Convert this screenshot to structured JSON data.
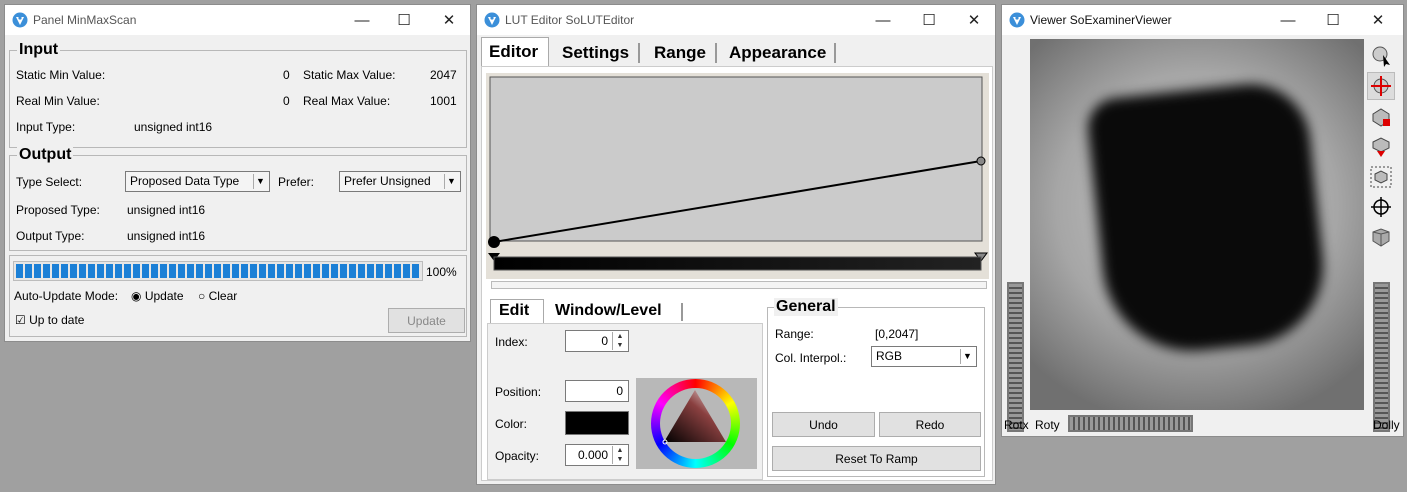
{
  "panel": {
    "title": "Panel MinMaxScan",
    "input": {
      "title": "Input",
      "static_min_label": "Static Min Value:",
      "static_min_value": "0",
      "static_max_label": "Static Max Value:",
      "static_max_value": "2047",
      "real_min_label": "Real Min Value:",
      "real_min_value": "0",
      "real_max_label": "Real Max Value:",
      "real_max_value": "1001",
      "input_type_label": "Input Type:",
      "input_type_value": "unsigned int16"
    },
    "output": {
      "title": "Output",
      "type_select_label": "Type Select:",
      "type_select_value": "Proposed Data Type",
      "prefer_label": "Prefer:",
      "prefer_value": "Prefer Unsigned",
      "proposed_type_label": "Proposed Type:",
      "proposed_type_value": "unsigned int16",
      "output_type_label": "Output Type:",
      "output_type_value": "unsigned int16"
    },
    "progress": {
      "percent_text": "100%",
      "fraction": 1.0
    },
    "auto_update_label": "Auto-Update Mode:",
    "radio_update": "Update",
    "radio_clear": "Clear",
    "up_to_date_label": "Up to date",
    "update_button": "Update"
  },
  "lut": {
    "title": "LUT Editor SoLUTEditor",
    "tabs": [
      "Editor",
      "Settings",
      "Range",
      "Appearance"
    ],
    "subtabs": [
      "Edit",
      "Window/Level"
    ],
    "index_label": "Index:",
    "index_value": "0",
    "position_label": "Position:",
    "position_value": "0",
    "color_label": "Color:",
    "opacity_label": "Opacity:",
    "opacity_value": "0.000",
    "general": {
      "title": "General",
      "range_label": "Range:",
      "range_value": "[0,2047]",
      "interp_label": "Col. Interpol.:",
      "interp_value": "RGB"
    },
    "undo_button": "Undo",
    "redo_button": "Redo",
    "reset_button": "Reset To Ramp"
  },
  "viewer": {
    "title": "Viewer SoExaminerViewer",
    "rotx_label": "Rotx",
    "roty_label": "Roty",
    "dolly_label": "Dolly"
  },
  "colors": {
    "accent": "#1a7fd6",
    "titlebar": "#ffffff",
    "panel": "#f0f0f0"
  }
}
